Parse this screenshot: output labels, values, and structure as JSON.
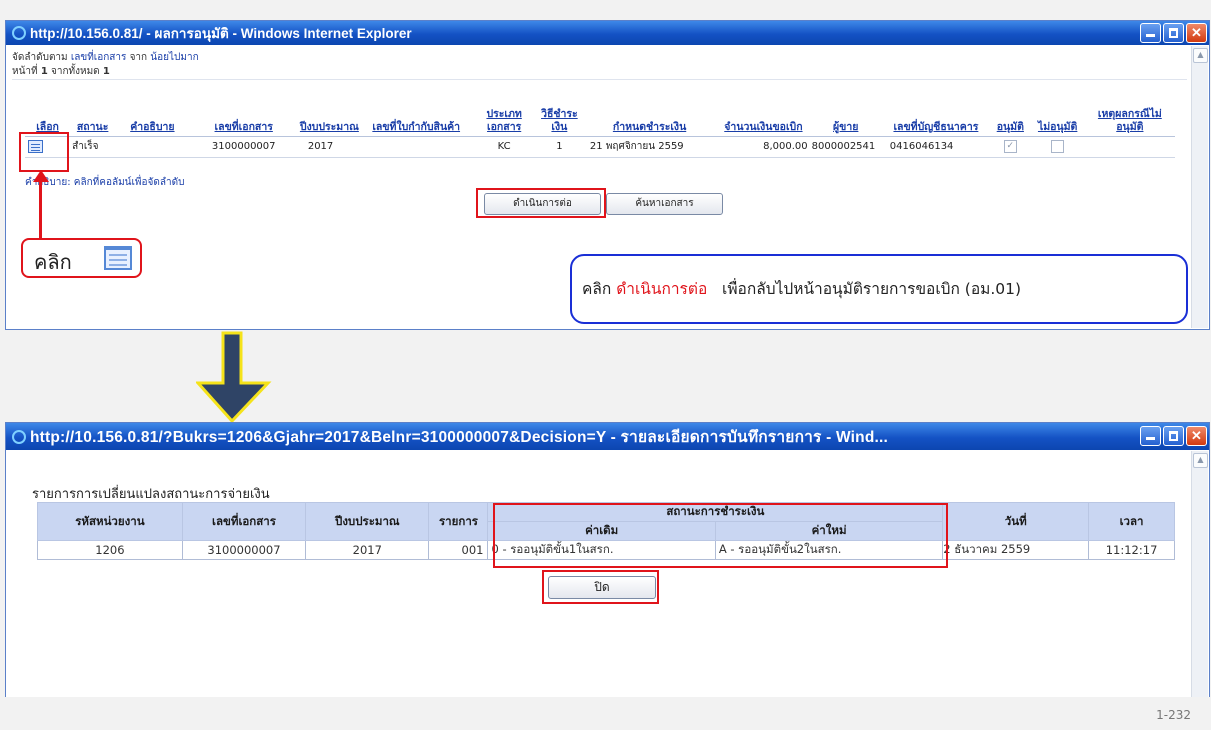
{
  "window1": {
    "title": "http://10.156.0.81/ - ผลการอนุมัติ - Windows Internet Explorer",
    "sort_line": {
      "prefix": "จัดลำดับตาม",
      "field": "เลขที่เอกสาร",
      "middle": "จาก",
      "order": "น้อยไปมาก"
    },
    "page_line": {
      "prefix": "หน้าที่",
      "page": "1",
      "middle": "จากทั้งหมด",
      "total": "1"
    },
    "headers": [
      "เลือก",
      "สถานะ",
      "คำอธิบาย",
      "เลขที่เอกสาร",
      "ปีงบประมาณ",
      "เลขที่ใบกำกับสินค้า",
      "ประเภทเอกสาร",
      "วิธีชำระเงิน",
      "กำหนดชำระเงิน",
      "จำนวนเงินขอเบิก",
      "ผู้ขาย",
      "เลขที่บัญชีธนาคาร",
      "อนุมัติ",
      "ไม่อนุมัติ",
      "เหตุผลกรณีไม่อนุมัติ"
    ],
    "row": {
      "status": "สำเร็จ",
      "description": "",
      "doc_no": "3100000007",
      "fiscal_year": "2017",
      "invoice_no": "",
      "doc_type": "KC",
      "pay_method": "1",
      "due_date": "21 พฤศจิกายน 2559",
      "amount": "8,000.00",
      "vendor": "8000002541",
      "bank_account": "0416046134",
      "approved": true,
      "not_approved": false,
      "reason": ""
    },
    "hint": "คำอธิบาย: คลิกที่คอลัมน์เพื่อจัดลำดับ",
    "continue_button": "ดำเนินการต่อ",
    "search_button": "ค้นหาเอกสาร"
  },
  "callout_click": {
    "text": "คลิก"
  },
  "callout_continue": {
    "prefix": "คลิก",
    "highlight": "ดำเนินการต่อ",
    "suffix": "เพื่อกลับไปหน้าอนุมัติรายการขอเบิก (อม.01)",
    "highlight_color": "#e0141b"
  },
  "window2": {
    "title": "http://10.156.0.81/?Bukrs=1206&Gjahr=2017&Belnr=3100000007&Decision=Y - รายละเอียดการบันทึกรายการ - Wind...",
    "section_title": "รายการการเปลี่ยนแปลงสถานะการจ่ายเงิน",
    "headers": {
      "unit": "รหัสหน่วยงาน",
      "doc_no": "เลขที่เอกสาร",
      "fiscal_year": "ปีงบประมาณ",
      "item": "รายการ",
      "payment_status": "สถานะการชำระเงิน",
      "old_value": "ค่าเดิม",
      "new_value": "ค่าใหม่",
      "date": "วันที่",
      "time": "เวลา"
    },
    "row": {
      "unit": "1206",
      "doc_no": "3100000007",
      "fiscal_year": "2017",
      "item": "001",
      "old_value": "0 - รออนุมัติขั้น1ในสรก.",
      "new_value": "A - รออนุมัติขั้น2ในสรก.",
      "date": "2 ธันวาคม 2559",
      "time": "11:12:17"
    },
    "close_button": "ปิด"
  },
  "page_number": "1-232",
  "colors": {
    "highlight_red": "#e0141b",
    "callout_border": "#1a2fd6",
    "arrow_fill": "#2f4466",
    "arrow_outline": "#f5e31a"
  }
}
